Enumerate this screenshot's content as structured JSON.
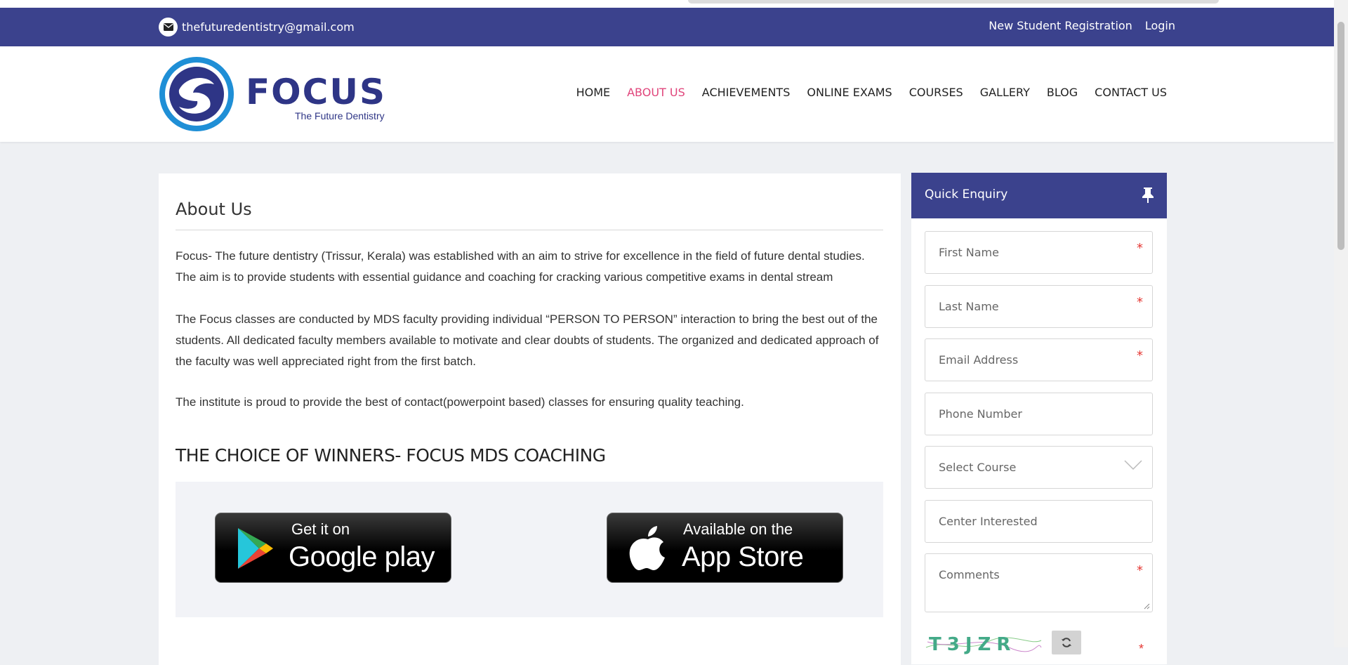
{
  "topbar": {
    "email": "thefuturedentistry@gmail.com",
    "registration_link": "New Student Registration",
    "login_link": "Login"
  },
  "logo": {
    "brand": "FOCUS",
    "tagline": "The Future Dentistry"
  },
  "nav": {
    "items": [
      "HOME",
      "ABOUT US",
      "ACHIEVEMENTS",
      "ONLINE EXAMS",
      "COURSES",
      "GALLERY",
      "BLOG",
      "CONTACT US"
    ],
    "active_index": 1
  },
  "about": {
    "title": "About Us",
    "paragraph_1": "Focus- The future dentistry (Trissur, Kerala) was established  with an aim to strive for excellence in the field of future dental studies. The aim is to provide students with essential guidance and coaching for cracking various competitive exams in dental stream",
    "paragraph_2": "The Focus classes are conducted by MDS faculty providing individual “PERSON TO PERSON” interaction to bring the best out of the students. All dedicated faculty members available to motivate and clear doubts of students. The organized and dedicated approach of the faculty was well appreciated right from the first batch.",
    "paragraph_3": " The institute is proud to provide the best of contact(powerpoint based) classes for ensuring quality teaching.",
    "subheading": "THE CHOICE OF WINNERS- FOCUS MDS COACHING"
  },
  "apps": {
    "google": {
      "small": "Get it on",
      "big": "Google play"
    },
    "apple": {
      "small": "Available on the",
      "big": "App Store"
    }
  },
  "enquiry": {
    "title": "Quick Enquiry",
    "fields": {
      "first_name": "First Name",
      "last_name": "Last Name",
      "email": "Email Address",
      "phone": "Phone Number",
      "course": "Select Course",
      "center": "Center Interested",
      "comments": "Comments"
    },
    "captcha_text": "T3JZR"
  },
  "colors": {
    "primary": "#3b428d",
    "active_nav": "#e0457b",
    "required": "#e53935"
  }
}
